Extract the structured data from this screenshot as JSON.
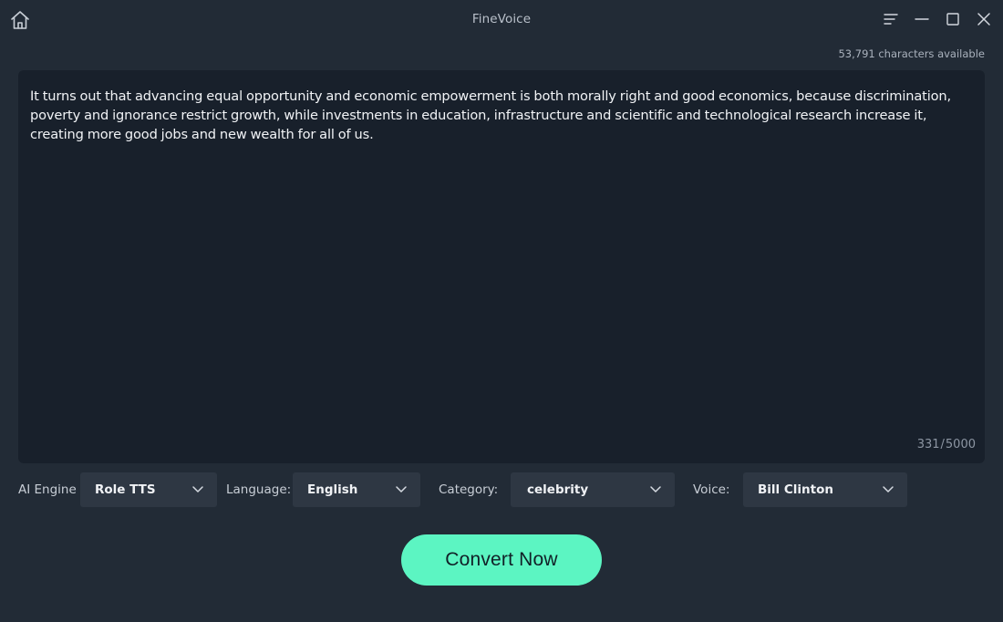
{
  "window": {
    "title": "FineVoice",
    "controls": [
      "menu-icon",
      "minimize-icon",
      "maximize-icon",
      "close-icon"
    ]
  },
  "quota": {
    "characters_available": "53,791 characters available"
  },
  "editor": {
    "text": "It turns out that advancing equal opportunity and economic empowerment is both morally right and good economics, because discrimination, poverty and ignorance restrict growth, while investments in education, infrastructure and scientific and technological research increase it, creating more good jobs and new wealth for all of us.",
    "count": "331",
    "separator": "/",
    "limit": "5000"
  },
  "controls": {
    "engine": {
      "label": "AI Engine",
      "value": "Role TTS"
    },
    "language": {
      "label": "Language:",
      "value": "English"
    },
    "category": {
      "label": "Category:",
      "value": "celebrity"
    },
    "voice": {
      "label": "Voice:",
      "value": "Bill Clinton"
    }
  },
  "actions": {
    "convert_label": "Convert Now"
  },
  "colors": {
    "background": "#222b36",
    "editor_background": "#18202b",
    "select_background": "#2e3743",
    "accent": "#5cf5c2"
  }
}
